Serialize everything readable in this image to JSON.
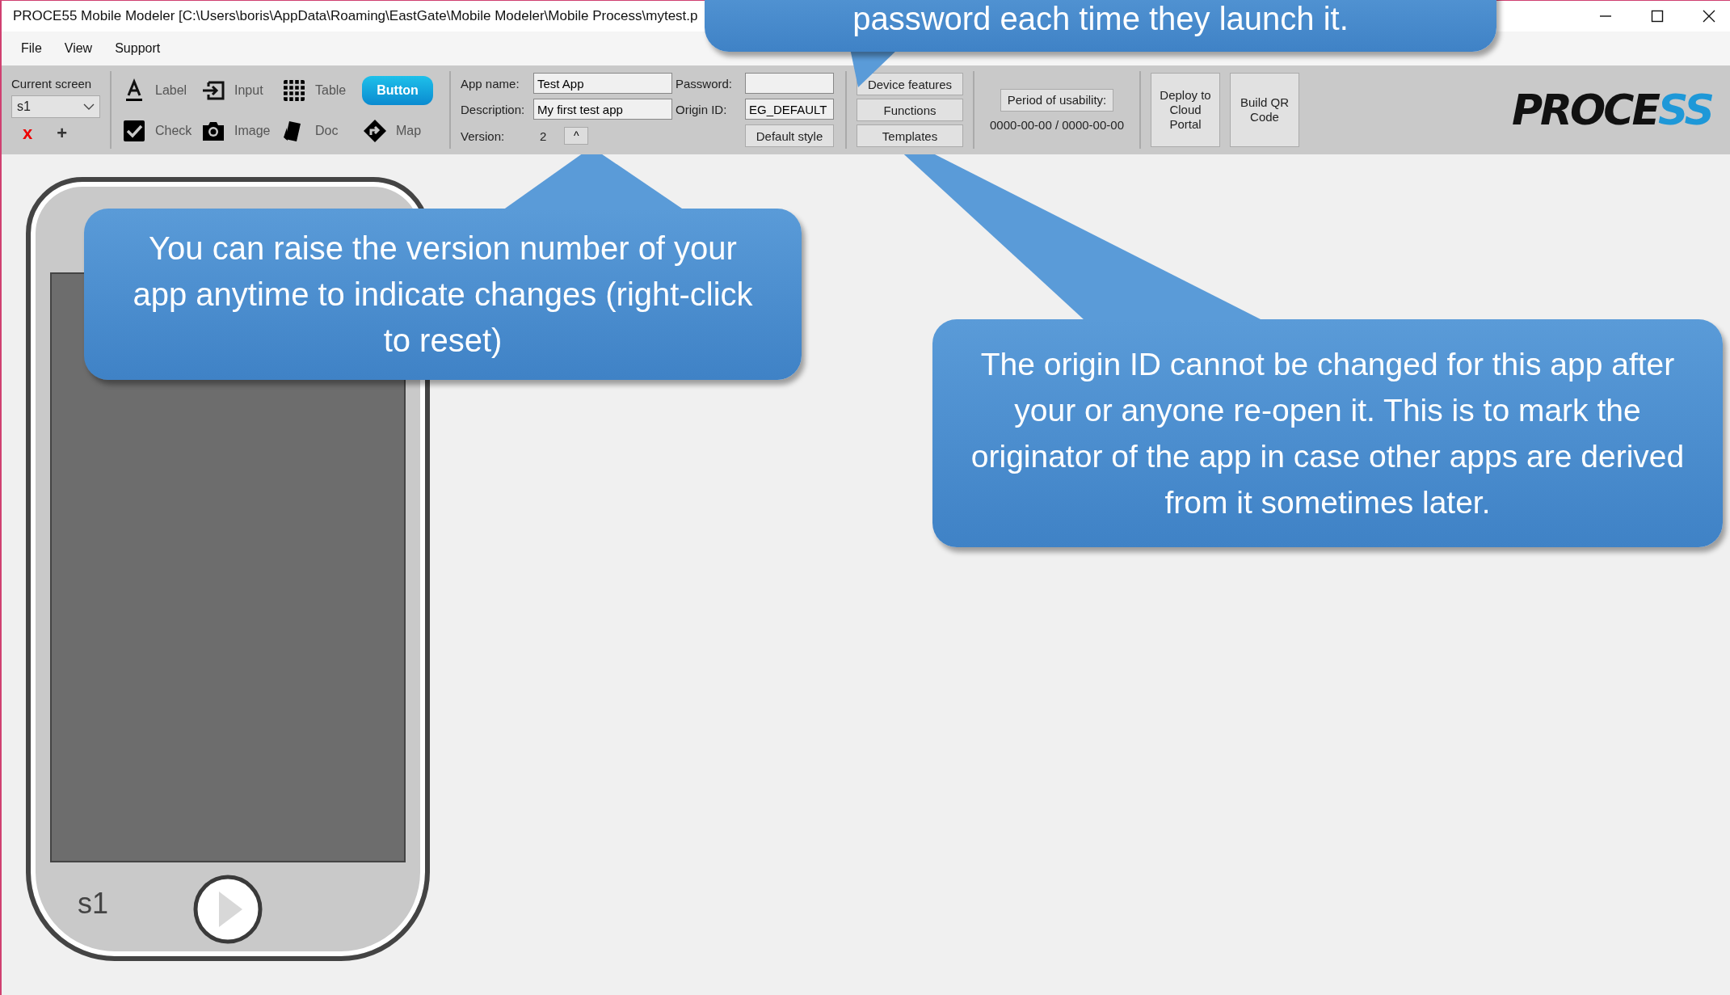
{
  "window": {
    "title": "PROCE55 Mobile Modeler [C:\\Users\\boris\\AppData\\Roaming\\EastGate\\Mobile Modeler\\Mobile Process\\mytest.p"
  },
  "menu": [
    "File",
    "View",
    "Support"
  ],
  "screen_selector": {
    "label": "Current screen",
    "value": "s1",
    "delete": "x",
    "add": "+"
  },
  "palette": [
    {
      "label": "Label",
      "kind": "tool"
    },
    {
      "label": "Input",
      "kind": "tool"
    },
    {
      "label": "Table",
      "kind": "tool"
    },
    {
      "label": "Button",
      "kind": "sample"
    },
    {
      "label": "Check",
      "kind": "tool"
    },
    {
      "label": "Image",
      "kind": "tool"
    },
    {
      "label": "Doc",
      "kind": "tool"
    },
    {
      "label": "Map",
      "kind": "tool"
    }
  ],
  "app_fields": {
    "app_name": {
      "label": "App name:",
      "value": "Test App"
    },
    "description": {
      "label": "Description:",
      "value": "My first test app"
    },
    "version": {
      "label": "Version:",
      "value": "2",
      "step": "^"
    },
    "password": {
      "label": "Password:"
    },
    "origin_id": {
      "label": "Origin ID:",
      "value": "EG_DEFAULT"
    },
    "default_style": "Default style"
  },
  "feature_buttons": [
    "Device features",
    "Functions",
    "Templates"
  ],
  "usability": {
    "label": "Period of usability:",
    "range": "0000-00-00 / 0000-00-00"
  },
  "actions": [
    "Deploy to Cloud Portal",
    "Build QR Code"
  ],
  "logo": {
    "dark": "PROCE",
    "accent": "SS"
  },
  "phone": {
    "screen_name": "s1"
  },
  "callouts": [
    {
      "text": "password each time they launch it."
    },
    {
      "text": "You can raise the version number of your app anytime to indicate changes (right-click to reset)"
    },
    {
      "text": "The origin ID cannot be changed for this app after your or anyone re-open it. This is to mark the originator of the app in case other apps are derived from it sometimes later."
    }
  ]
}
